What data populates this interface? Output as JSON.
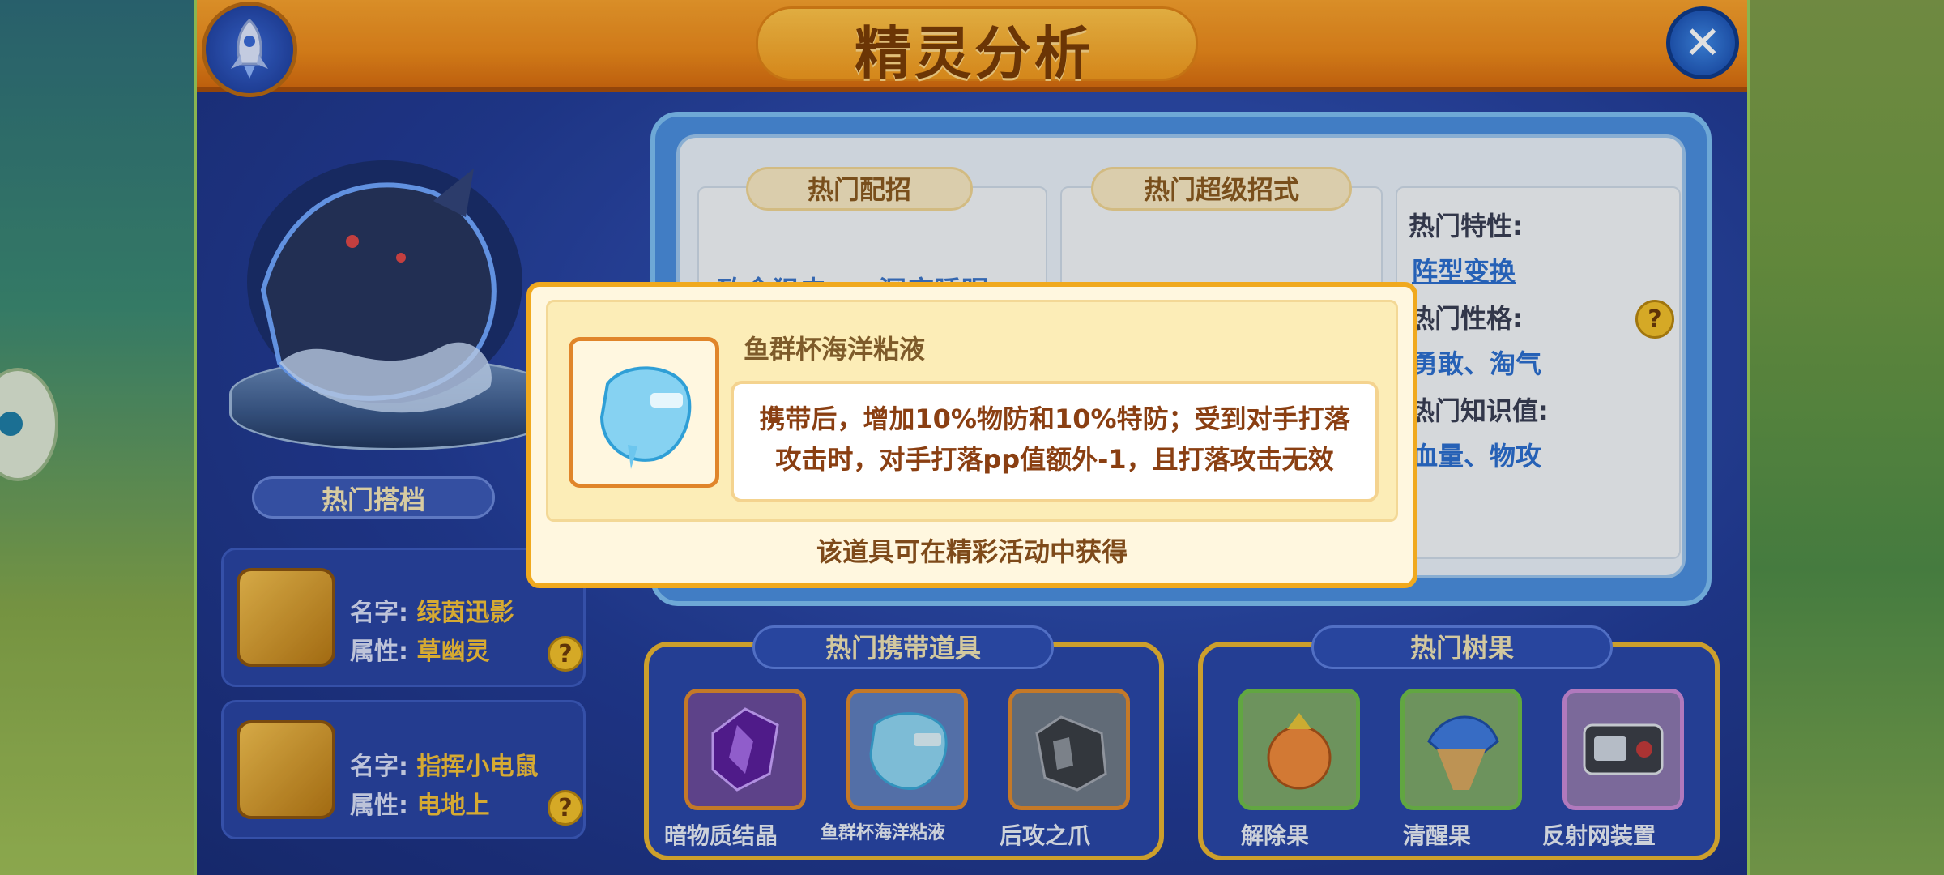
{
  "title": "精灵分析",
  "sections": {
    "partners_label": "热门搭档",
    "moves_label": "热门配招",
    "super_moves_label": "热门超级招式",
    "held_items_label": "热门携带道具",
    "berries_label": "热门树果"
  },
  "partners": [
    {
      "name_key": "名字:",
      "name_value": "绿茵迅影",
      "attr_key": "属性:",
      "attr_value": "草幽灵",
      "help": "?"
    },
    {
      "name_key": "名字:",
      "name_value": "指挥小电鼠",
      "attr_key": "属性:",
      "attr_value": "电地上",
      "help": "?"
    }
  ],
  "moves_faint": [
    "致命狙击",
    "深度睡眠"
  ],
  "traits": {
    "ability_label": "热门特性:",
    "ability_value": "阵型变换",
    "nature_label": "热门性格:",
    "nature_value": "勇敢、淘气",
    "ev_label": "热门知识值:",
    "ev_value": "血量、物攻",
    "help": "?"
  },
  "held_items": [
    {
      "name": "暗物质结晶",
      "icon": "dark-crystal-icon"
    },
    {
      "name": "鱼群杯海洋粘液",
      "icon": "slime-icon"
    },
    {
      "name": "后攻之爪",
      "icon": "claw-icon"
    }
  ],
  "berries": [
    {
      "name": "解除果",
      "icon": "berry-icon"
    },
    {
      "name": "清醒果",
      "icon": "seed-icon"
    },
    {
      "name": "反射网装置",
      "icon": "device-icon"
    }
  ],
  "popup": {
    "item_name": "鱼群杯海洋粘液",
    "desc_line1": "携带后，增加10%物防和10%特防；受到对手打落",
    "desc_line2": "攻击时，对手打落pp值额外-1，且打落攻击无效",
    "footer": "该道具可在精彩活动中获得"
  },
  "close_glyph": "✕"
}
